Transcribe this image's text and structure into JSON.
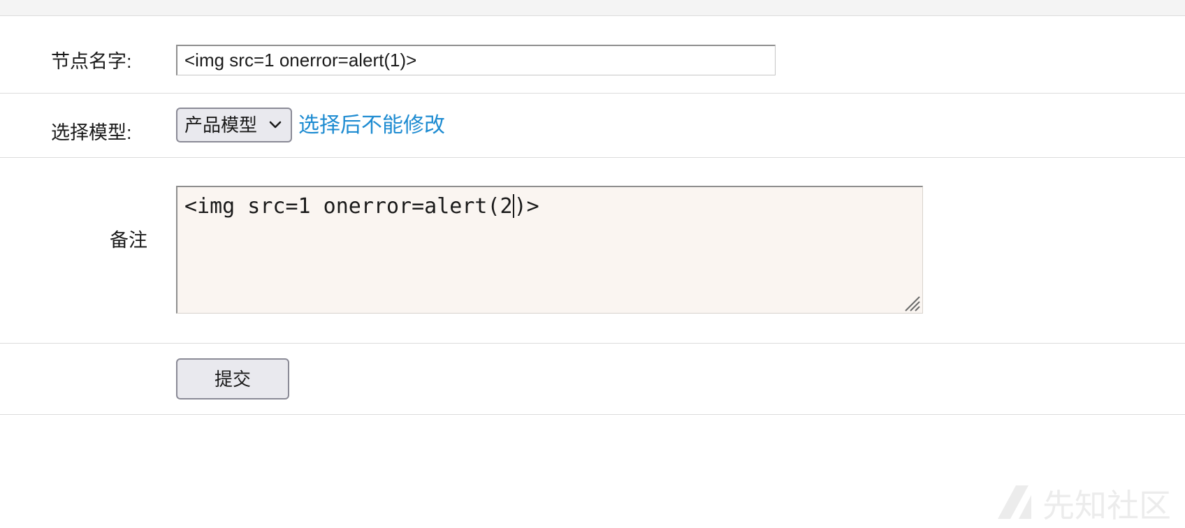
{
  "form": {
    "node_name": {
      "label": "节点名字:",
      "value": "<img src=1 onerror=alert(1)>"
    },
    "model": {
      "label": "选择模型:",
      "selected": "产品模型",
      "hint": "选择后不能修改"
    },
    "note": {
      "label": "备注",
      "value_before_caret": "<img src=1 onerror=alert(2",
      "value_after_caret": ")>"
    },
    "submit_label": "提交"
  },
  "watermark": {
    "text": "先知社区"
  },
  "colors": {
    "hint_link": "#1d8bd1",
    "textarea_bg": "#faf5f1",
    "button_bg": "#e9e9ee",
    "divider": "#dcdcdc"
  },
  "icons": [
    "chevron-down-icon",
    "resize-grip-icon",
    "xianzhi-logo-icon"
  ]
}
